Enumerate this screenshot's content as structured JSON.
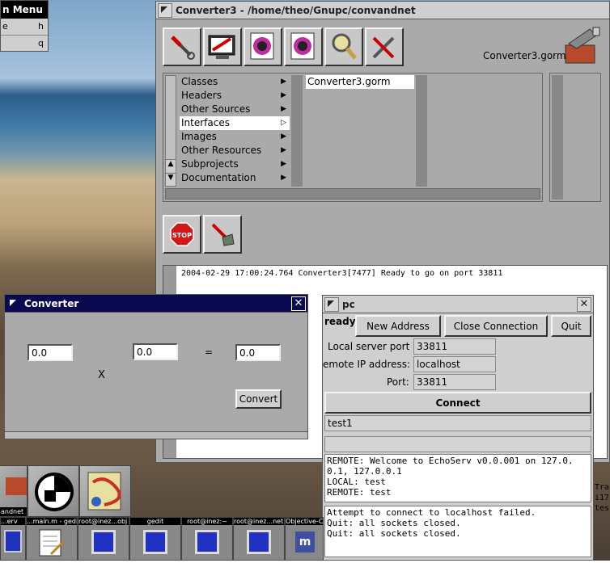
{
  "menu": {
    "title": "n Menu",
    "items": [
      {
        "label": "e",
        "shortcut": "h"
      },
      {
        "label": "",
        "shortcut": "q"
      }
    ]
  },
  "main_window": {
    "title": "Converter3 - /home/theo/Gnupc/convandnet",
    "file_label": "Converter3.gorm",
    "toolbar": [
      "inspector-icon",
      "monitor-icon",
      "gorm-file-icon",
      "gorm-file2-icon",
      "magnifier-icon",
      "tools-icon"
    ],
    "browser_col1": [
      "Classes",
      "Headers",
      "Other Sources",
      "Interfaces",
      "Images",
      "Other Resources",
      "Subprojects",
      "Documentation"
    ],
    "selected_index": 3,
    "browser_col2": [
      "Converter3.gorm"
    ],
    "log_text": "2004-02-29 17:00:24.764 Converter3[7477] Ready to go on port 33811"
  },
  "converter_window": {
    "title": "Converter",
    "field1": "0.0",
    "field2": "0.0",
    "field3": "0.0",
    "times": "X",
    "equals": "=",
    "convert_label": "Convert"
  },
  "pc_window": {
    "title": "pc",
    "status": "ready",
    "new_address": "New Address",
    "close_connection": "Close Connection",
    "quit": "Quit",
    "local_port_label": "Local server port",
    "local_port_value": "33811",
    "remote_ip_label": "emote IP address:",
    "remote_ip_value": "localhost",
    "port_label": "Port:",
    "port_value": "33811",
    "connect": "Connect",
    "message_value": "test1",
    "log1": [
      "REMOTE: Welcome to EchoServ v0.0.001 on 127.0.",
      "0.1, 127.0.0.1",
      "LOCAL: test",
      "REMOTE: test"
    ],
    "log2": [
      "Attempt to connect to localhost failed.",
      "Quit: all sockets closed.",
      "Quit: all sockets closed."
    ]
  },
  "dock_labels": [
    "andnet",
    "",
    ""
  ],
  "taskbar": [
    "...erv",
    "...main.m - gedit",
    "root@inez...obj",
    "gedit",
    "root@inez:~",
    "root@inez...net",
    "Objective-C"
  ],
  "edge_text": [
    "Tra",
    "i17",
    "tes"
  ]
}
